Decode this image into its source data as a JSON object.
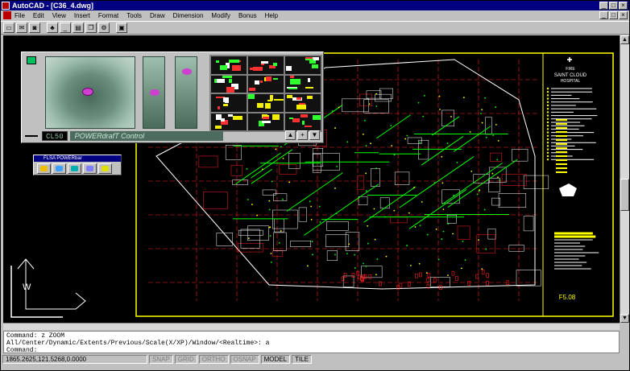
{
  "window": {
    "title": "AutoCAD - [C36_4.dwg]",
    "controls": [
      "_",
      "□",
      "×"
    ]
  },
  "menu": [
    "File",
    "Edit",
    "View",
    "Insert",
    "Format",
    "Tools",
    "Draw",
    "Dimension",
    "Modify",
    "Bonus",
    "Help"
  ],
  "mdi_controls": [
    "_",
    "□",
    "×"
  ],
  "toolbar": [
    {
      "icon": "open-icon",
      "glyph": "▭"
    },
    {
      "icon": "mail-icon",
      "glyph": "✉"
    },
    {
      "icon": "camera-icon",
      "glyph": "◙"
    },
    {
      "icon": "tree-icon",
      "glyph": "♣"
    },
    {
      "icon": "minimize-icon",
      "glyph": "_"
    },
    {
      "icon": "window-icon",
      "glyph": "▤"
    },
    {
      "icon": "cascade-icon",
      "glyph": "❐"
    },
    {
      "icon": "settings-icon",
      "glyph": "⚙"
    },
    {
      "icon": "save-icon",
      "glyph": "▣"
    }
  ],
  "powerpanel": {
    "lcd": "CL50",
    "label": "POWERdrafT Control",
    "arrows": [
      "▲",
      "+",
      "▼"
    ]
  },
  "powerbar": {
    "title": "FLSA POWERbar"
  },
  "title_block": {
    "line1": "FIRE",
    "line2": "SAINT CLOUD",
    "line3": "HOSPITAL",
    "sheet": "F5.08"
  },
  "command": {
    "line1": "Command: z ZOOM",
    "line2": "All/Center/Dynamic/Extents/Previous/Scale(X/XP)/Window/<Realtime>: a",
    "line3": "Command:"
  },
  "status": {
    "coords": "1865.2625,121.5268,0.0000",
    "toggles": [
      {
        "label": "SNAP",
        "on": false
      },
      {
        "label": "GRID",
        "on": false
      },
      {
        "label": "ORTHO",
        "on": false
      },
      {
        "label": "OSNAP",
        "on": false
      },
      {
        "label": "MODEL",
        "on": true
      },
      {
        "label": "TILE",
        "on": true
      }
    ]
  },
  "colors": {
    "canvas": "#000000",
    "frame": "#ffff00",
    "grid": "#ff2020",
    "pipe": "#00ff00",
    "walls": "#ffffff",
    "accent": "#000080"
  }
}
